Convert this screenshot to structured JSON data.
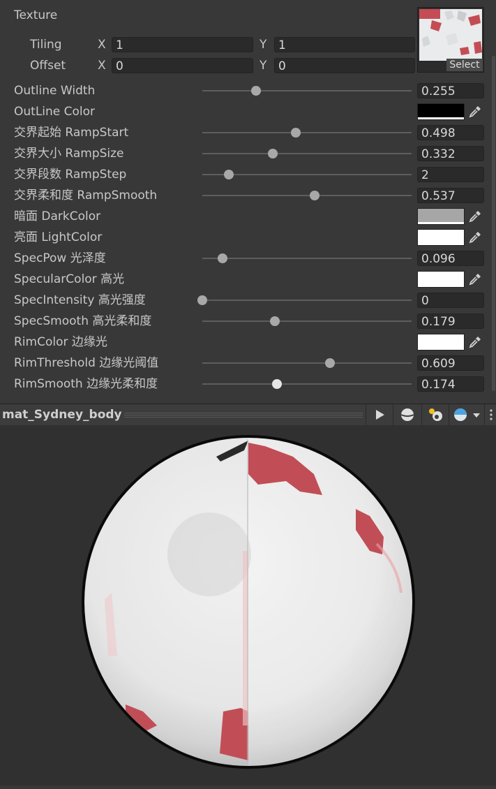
{
  "texture": {
    "heading": "Texture",
    "tiling_label": "Tiling",
    "offset_label": "Offset",
    "axis_x": "X",
    "axis_y": "Y",
    "tiling_x": "1",
    "tiling_y": "1",
    "offset_x": "0",
    "offset_y": "0",
    "select_label": "Select"
  },
  "properties": [
    {
      "label": "Outline Width",
      "kind": "slider",
      "value": "0.255",
      "fraction": 0.255
    },
    {
      "label": "OutLine Color",
      "kind": "color",
      "color": "#000000"
    },
    {
      "label": "交界起始 RampStart",
      "kind": "slider",
      "value": "0.498",
      "fraction": 0.445
    },
    {
      "label": "交界大小 RampSize",
      "kind": "slider",
      "value": "0.332",
      "fraction": 0.335
    },
    {
      "label": "交界段数 RampStep",
      "kind": "slider",
      "value": "2",
      "fraction": 0.125
    },
    {
      "label": "交界柔和度 RampSmooth",
      "kind": "slider",
      "value": "0.537",
      "fraction": 0.537
    },
    {
      "label": "暗面 DarkColor",
      "kind": "color",
      "color": "#a6a6a6"
    },
    {
      "label": "亮面 LightColor",
      "kind": "color",
      "color": "#ffffff"
    },
    {
      "label": "SpecPow 光泽度",
      "kind": "slider",
      "value": "0.096",
      "fraction": 0.096
    },
    {
      "label": "SpecularColor 高光",
      "kind": "color",
      "color": "#ffffff"
    },
    {
      "label": "SpecIntensity 高光强度",
      "kind": "slider",
      "value": "0",
      "fraction": 0.0
    },
    {
      "label": "SpecSmooth 高光柔和度",
      "kind": "slider",
      "value": "0.179",
      "fraction": 0.345
    },
    {
      "label": "RimColor 边缘光",
      "kind": "color",
      "color": "#ffffff"
    },
    {
      "label": "RimThreshold 边缘光阈值",
      "kind": "slider",
      "value": "0.609",
      "fraction": 0.609
    },
    {
      "label": "RimSmooth 边缘光柔和度",
      "kind": "slider",
      "value": "0.174",
      "fraction": 0.358
    }
  ],
  "preview": {
    "material_name": "mat_Sydney_body"
  },
  "colors": {
    "panel_bg": "#383838",
    "field_bg": "#2a2a2a",
    "sphere_tint": "#c04a50"
  },
  "icons": [
    "eyedropper-icon",
    "play-icon",
    "sphere-shape-icon",
    "light-icon",
    "background-sphere-icon",
    "dropdown-arrow-icon",
    "kebab-menu-icon"
  ]
}
